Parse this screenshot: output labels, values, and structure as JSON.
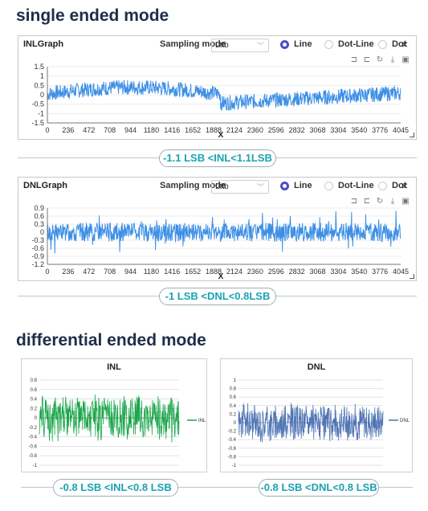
{
  "headings": {
    "single": "single ended mode",
    "differential": "differential ended mode"
  },
  "inl_panel": {
    "title": "INLGraph",
    "sampling_mode_label": "Sampling mode",
    "sampling_mode_value": "Lttb",
    "radio_options": [
      "Line",
      "Dot-Line",
      "Dot"
    ],
    "selected_option": "Line",
    "close_label": "×",
    "y_ticks": [
      "1.5",
      "1",
      "0.5",
      "0",
      "-0.5",
      "-1",
      "-1.5"
    ],
    "x_ticks": [
      "0",
      "236",
      "472",
      "708",
      "944",
      "1180",
      "1416",
      "1652",
      "1888",
      "2124",
      "2360",
      "2596",
      "2832",
      "3068",
      "3304",
      "3540",
      "3776",
      "4045"
    ],
    "x_axis_label": "X",
    "caption": "-1.1 LSB <INL<1.1LSB"
  },
  "dnl_panel": {
    "title": "DNLGraph",
    "sampling_mode_label": "Sampling mode",
    "sampling_mode_value": "Lttb",
    "radio_options": [
      "Line",
      "Dot-Line",
      "Dot"
    ],
    "selected_option": "Line",
    "close_label": "×",
    "y_ticks": [
      "0.9",
      "0.6",
      "0.3",
      "0",
      "-0.3",
      "-0.6",
      "-0.9",
      "-1.2"
    ],
    "x_ticks": [
      "0",
      "236",
      "472",
      "708",
      "944",
      "1180",
      "1416",
      "1652",
      "1888",
      "2124",
      "2360",
      "2596",
      "2832",
      "3068",
      "3304",
      "3540",
      "3776",
      "4045"
    ],
    "x_axis_label": "X",
    "caption": "-1 LSB <DNL<0.8LSB"
  },
  "diff_inl": {
    "title": "INL",
    "legend": "INL",
    "y_ticks": [
      "0.8",
      "0.6",
      "0.4",
      "0.2",
      "0",
      "-0.2",
      "-0.4",
      "-0.6",
      "-0.8",
      "-1"
    ],
    "caption": "-0.8 LSB <INL<0.8 LSB"
  },
  "diff_dnl": {
    "title": "DNL",
    "legend": "DNL",
    "y_ticks": [
      "1",
      "0.8",
      "0.6",
      "0.4",
      "0.2",
      "0",
      "-0.2",
      "-0.4",
      "-0.6",
      "-0.8",
      "-1"
    ],
    "caption": "-0.8 LSB <DNL<0.8 LSB"
  },
  "icons": [
    "zoom-select-icon",
    "zoom-reset-icon",
    "refresh-icon",
    "download-icon",
    "save-icon"
  ],
  "colors": {
    "accent_blue": "#3d8fe6",
    "excel_green": "#19a64a",
    "excel_blue": "#4f74b5",
    "caption_teal": "#1aa3b3",
    "radio_selected": "#4b4bc8"
  }
}
